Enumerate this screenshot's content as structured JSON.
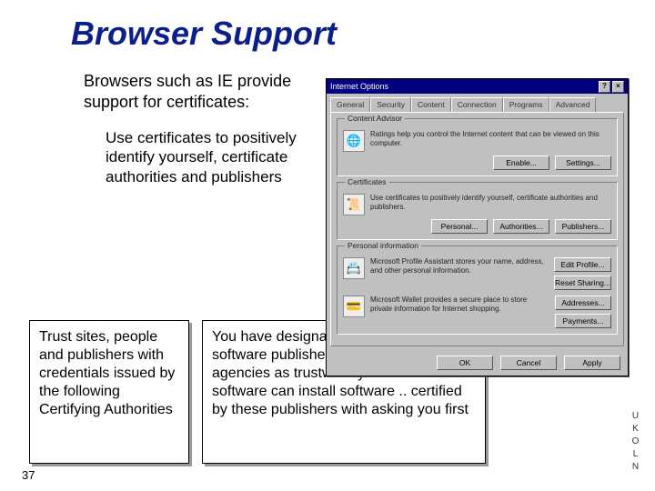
{
  "title": "Browser Support",
  "desc": "Browsers such as IE provide support for certificates:",
  "sub": "Use certificates to positively identify yourself, certificate authorities and publishers",
  "box1": "Trust sites, people and publishers with credentials issued by the following Certifying Authorities",
  "box2": "You have designated the following software publishers and credential agencies as trustworthy.  Windows software can install software .. certified by these publishers with asking  you first",
  "page": "37",
  "logo": "UKOLN",
  "dlg": {
    "title": "Internet Options",
    "help": "?",
    "close": "×",
    "tabs": [
      "General",
      "Security",
      "Content",
      "Connection",
      "Programs",
      "Advanced"
    ],
    "g1": {
      "label": "Content Advisor",
      "text": "Ratings help you control the Internet content that can be viewed on this computer.",
      "icon": "🌐",
      "btns": [
        "Enable...",
        "Settings..."
      ]
    },
    "g2": {
      "label": "Certificates",
      "text": "Use certificates to positively identify yourself, certificate authorities and publishers.",
      "icon": "📜",
      "btns": [
        "Personal...",
        "Authorities...",
        "Publishers..."
      ]
    },
    "g3": {
      "label": "Personal information",
      "row1": {
        "text": "Microsoft Profile Assistant stores your name, address, and other personal information.",
        "icon": "📇",
        "btns": [
          "Edit Profile...",
          "Reset Sharing..."
        ]
      },
      "row2": {
        "text": "Microsoft Wallet provides a secure place to store private information for Internet shopping.",
        "icon": "💳",
        "btns": [
          "Addresses...",
          "Payments..."
        ]
      }
    },
    "footer": [
      "OK",
      "Cancel",
      "Apply"
    ]
  }
}
